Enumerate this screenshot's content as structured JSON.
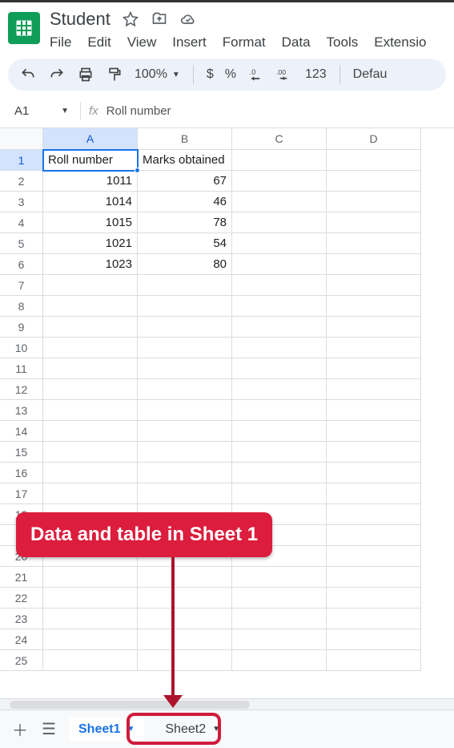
{
  "header": {
    "doc_title": "Student",
    "menus": [
      "File",
      "Edit",
      "View",
      "Insert",
      "Format",
      "Data",
      "Tools",
      "Extensio"
    ]
  },
  "toolbar": {
    "zoom": "100%",
    "currency": "$",
    "percent": "%",
    "dec_dec": ".0",
    "inc_dec": ".00",
    "num_format": "123",
    "font": "Defau"
  },
  "formula_bar": {
    "name_box": "A1",
    "fx_label": "fx",
    "value": "Roll number"
  },
  "grid": {
    "columns": [
      "A",
      "B",
      "C",
      "D"
    ],
    "selected_col": "A",
    "selected_row": 1,
    "row_count": 25,
    "cells": {
      "A1": "Roll number",
      "B1": "Marks obtained",
      "A2": "1011",
      "B2": "67",
      "A3": "1014",
      "B3": "46",
      "A4": "1015",
      "B4": "78",
      "A5": "1021",
      "B5": "54",
      "A6": "1023",
      "B6": "80"
    }
  },
  "sheets": {
    "tabs": [
      {
        "label": "Sheet1",
        "active": true
      },
      {
        "label": "Sheet2",
        "active": false
      }
    ]
  },
  "annotation": {
    "callout": "Data and table in Sheet 1"
  },
  "chart_data": {
    "type": "table",
    "columns": [
      "Roll number",
      "Marks obtained"
    ],
    "rows": [
      [
        1011,
        67
      ],
      [
        1014,
        46
      ],
      [
        1015,
        78
      ],
      [
        1021,
        54
      ],
      [
        1023,
        80
      ]
    ]
  }
}
